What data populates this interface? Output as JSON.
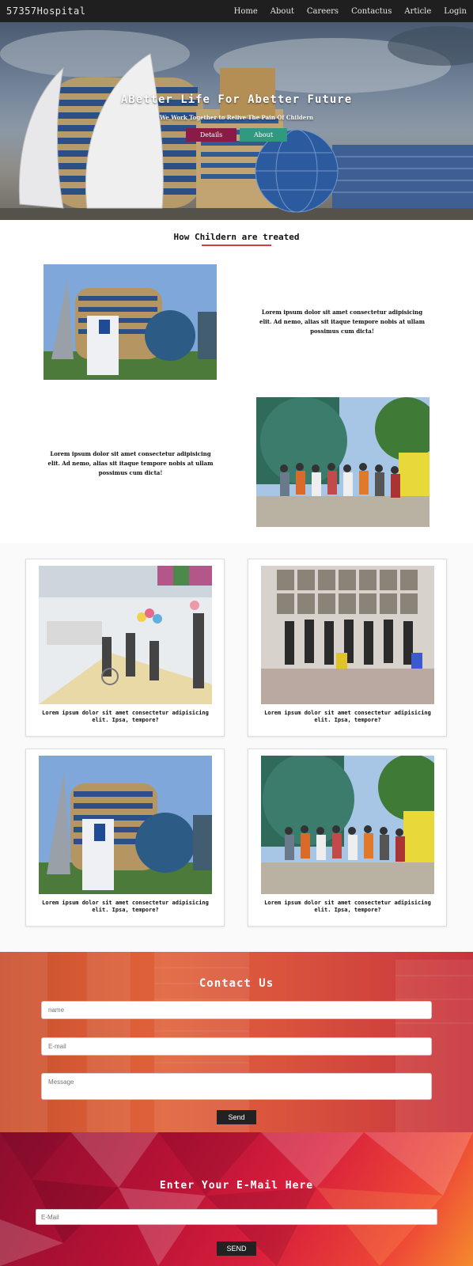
{
  "nav": {
    "brand": "57357Hospital",
    "links": [
      "Home",
      "About",
      "Careers",
      "Contactus",
      "Article",
      "Login"
    ]
  },
  "hero": {
    "title": "ABetter Life For Abetter Future",
    "subtitle": "We Work Together to Relive The Pain Of Childern",
    "details_label": "Details",
    "about_label": "About"
  },
  "treated": {
    "title": "How Childern are treated",
    "paragraph1": "Lorem ipsum dolor sit amet consectetur adipisicing elit. Ad nemo, alias sit itaque tempore nobis at ullam possimus cum dicta!",
    "paragraph2": "Lorem ipsum dolor sit amet consectetur adipisicing elit. Ad nemo, alias sit itaque tempore nobis at ullam possimus cum dicta!"
  },
  "cards": [
    {
      "caption": "Lorem ipsum dolor sit amet consectetur adipisicing elit. Ipsa, tempore?"
    },
    {
      "caption": "Lorem ipsum dolor sit amet consectetur adipisicing elit. Ipsa, tempore?"
    },
    {
      "caption": "Lorem ipsum dolor sit amet consectetur adipisicing elit. Ipsa, tempore?"
    },
    {
      "caption": "Lorem ipsum dolor sit amet consectetur adipisicing elit. Ipsa, tempore?"
    }
  ],
  "contact": {
    "title": "Contact Us",
    "name_placeholder": "name",
    "email_placeholder": "E-mail",
    "message_placeholder": "Message",
    "send_label": "Send"
  },
  "newsletter": {
    "title": "Enter Your E-Mail Here",
    "email_placeholder": "E-Mail",
    "send_label": "SEND"
  }
}
